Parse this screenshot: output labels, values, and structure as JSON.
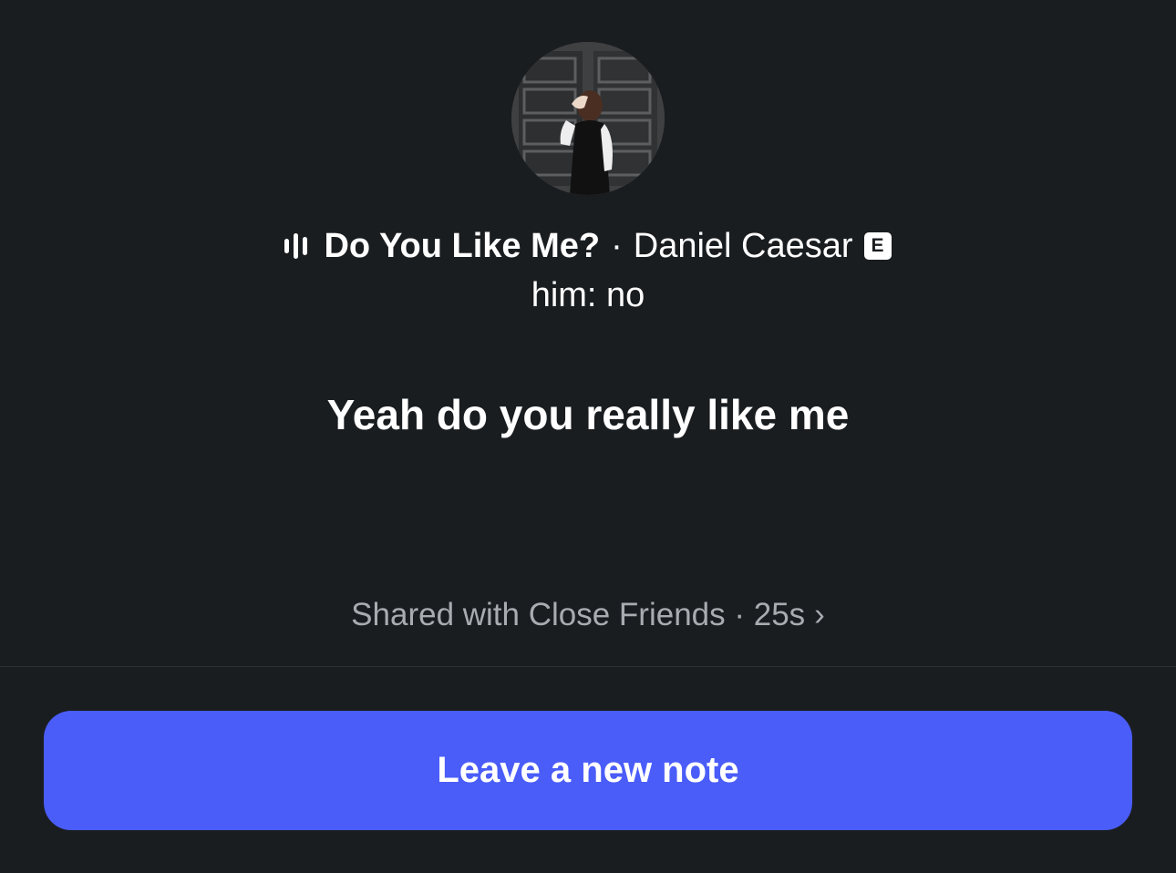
{
  "note": {
    "song_title": "Do You Like Me?",
    "separator": "·",
    "artist": "Daniel Caesar",
    "explicit_badge": "E",
    "caption": "him: no",
    "lyric": "Yeah do you really like me"
  },
  "footer": {
    "shared_text": "Shared with Close Friends · 25s",
    "chevron": "›"
  },
  "actions": {
    "primary_label": "Leave a new note"
  },
  "icons": {
    "music": "audio-wave-icon",
    "explicit": "explicit-badge-icon",
    "more": "chevron-right-icon"
  },
  "colors": {
    "background": "#1a1d20",
    "button": "#4a5df9",
    "muted_text": "#a8acb0"
  }
}
